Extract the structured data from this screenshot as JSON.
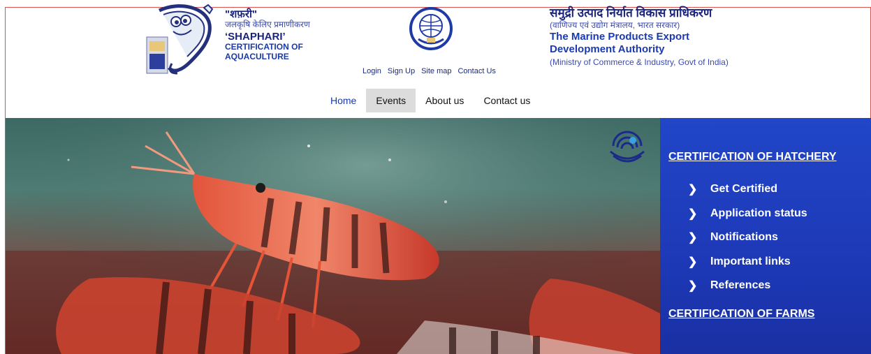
{
  "header": {
    "shaphari_hindi": "\"शफ़री\"",
    "shaphari_hindi_sub": "जलकृषि केलिए प्रमाणीकरण",
    "shaphari_en": "‘SHAPHARI’",
    "shaphari_sub1": "CERTIFICATION OF",
    "shaphari_sub2": "AQUACULTURE",
    "mpeda_hindi": "समुद्री उत्पाद निर्यात विकास प्राधिकरण",
    "mpeda_hindi_sub": "(वाणिज्य एवं उद्योग मंत्रालय, भारत सरकार)",
    "mpeda_en1": "The Marine Products Export",
    "mpeda_en2": "Development Authority",
    "mpeda_en_sub": "(Ministry of Commerce & Industry, Govt of India)"
  },
  "util_links": {
    "login": "Login",
    "signup": "Sign Up",
    "sitemap": "Site map",
    "contact": "Contact Us"
  },
  "nav": {
    "home": "Home",
    "events": "Events",
    "about": "About us",
    "contact": "Contact us"
  },
  "sidebar": {
    "hatchery_title": "CERTIFICATION OF HATCHERY",
    "items": [
      {
        "label": "Get Certified"
      },
      {
        "label": "Application status"
      },
      {
        "label": "Notifications"
      },
      {
        "label": "Important links"
      },
      {
        "label": "References"
      }
    ],
    "farms_title": "CERTIFICATION OF FARMS"
  },
  "colors": {
    "brand_blue": "#1a237e",
    "sidebar_bg": "#1f3fc0",
    "active_nav_bg": "#dcdcdc",
    "frame_red": "#d9534f"
  }
}
